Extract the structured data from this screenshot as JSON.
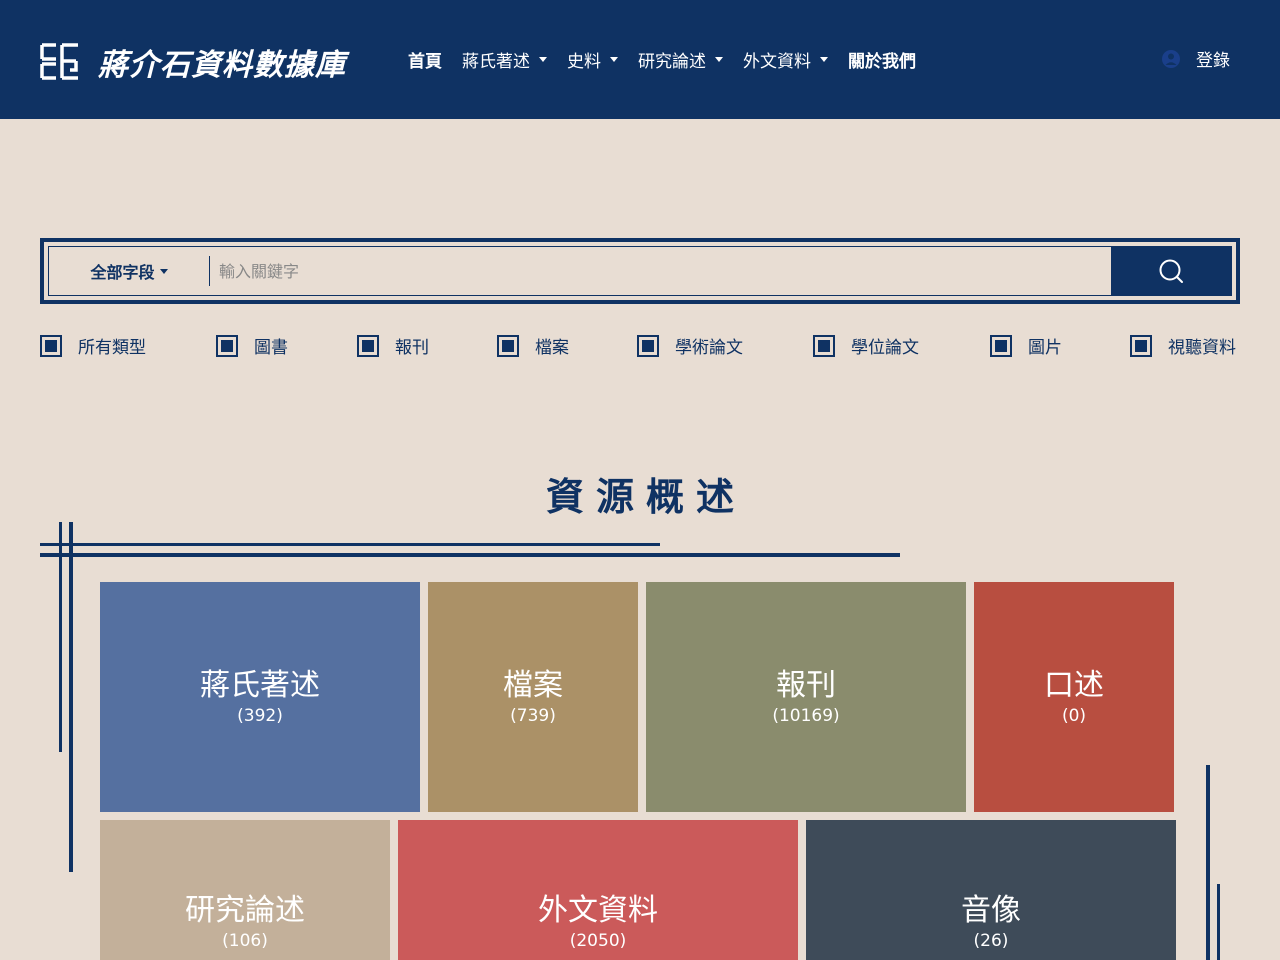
{
  "header": {
    "site_title": "蔣介石資料數據庫",
    "nav": [
      {
        "label": "首頁",
        "dropdown": false
      },
      {
        "label": "蔣氏著述",
        "dropdown": true
      },
      {
        "label": "史料",
        "dropdown": true
      },
      {
        "label": "研究論述",
        "dropdown": true
      },
      {
        "label": "外文資料",
        "dropdown": true
      },
      {
        "label": "關於我們",
        "dropdown": false
      }
    ],
    "login_label": "登錄"
  },
  "search": {
    "field_label": "全部字段",
    "placeholder": "輸入關鍵字",
    "button_icon": "search-icon"
  },
  "filters": [
    {
      "label": "所有類型",
      "checked": true
    },
    {
      "label": "圖書",
      "checked": true
    },
    {
      "label": "報刊",
      "checked": true
    },
    {
      "label": "檔案",
      "checked": true
    },
    {
      "label": "學術論文",
      "checked": true
    },
    {
      "label": "學位論文",
      "checked": true
    },
    {
      "label": "圖片",
      "checked": true
    },
    {
      "label": "視聽資料",
      "checked": true
    }
  ],
  "overview": {
    "title": "資源概述",
    "tiles": [
      {
        "name": "蔣氏著述",
        "count": "(392)",
        "color": "#5570a0"
      },
      {
        "name": "檔案",
        "count": "(739)",
        "color": "#ab9167"
      },
      {
        "name": "報刊",
        "count": "(10169)",
        "color": "#8a8c6d"
      },
      {
        "name": "口述",
        "count": "(0)",
        "color": "#b84e40"
      },
      {
        "name": "研究論述",
        "count": "(106)",
        "color": "#c3b09a"
      },
      {
        "name": "外文資料",
        "count": "(2050)",
        "color": "#cb5a5a"
      },
      {
        "name": "音像",
        "count": "(26)",
        "color": "#3e4b59"
      }
    ]
  },
  "colors": {
    "primary": "#0f3263",
    "background": "#e8ddd3"
  }
}
